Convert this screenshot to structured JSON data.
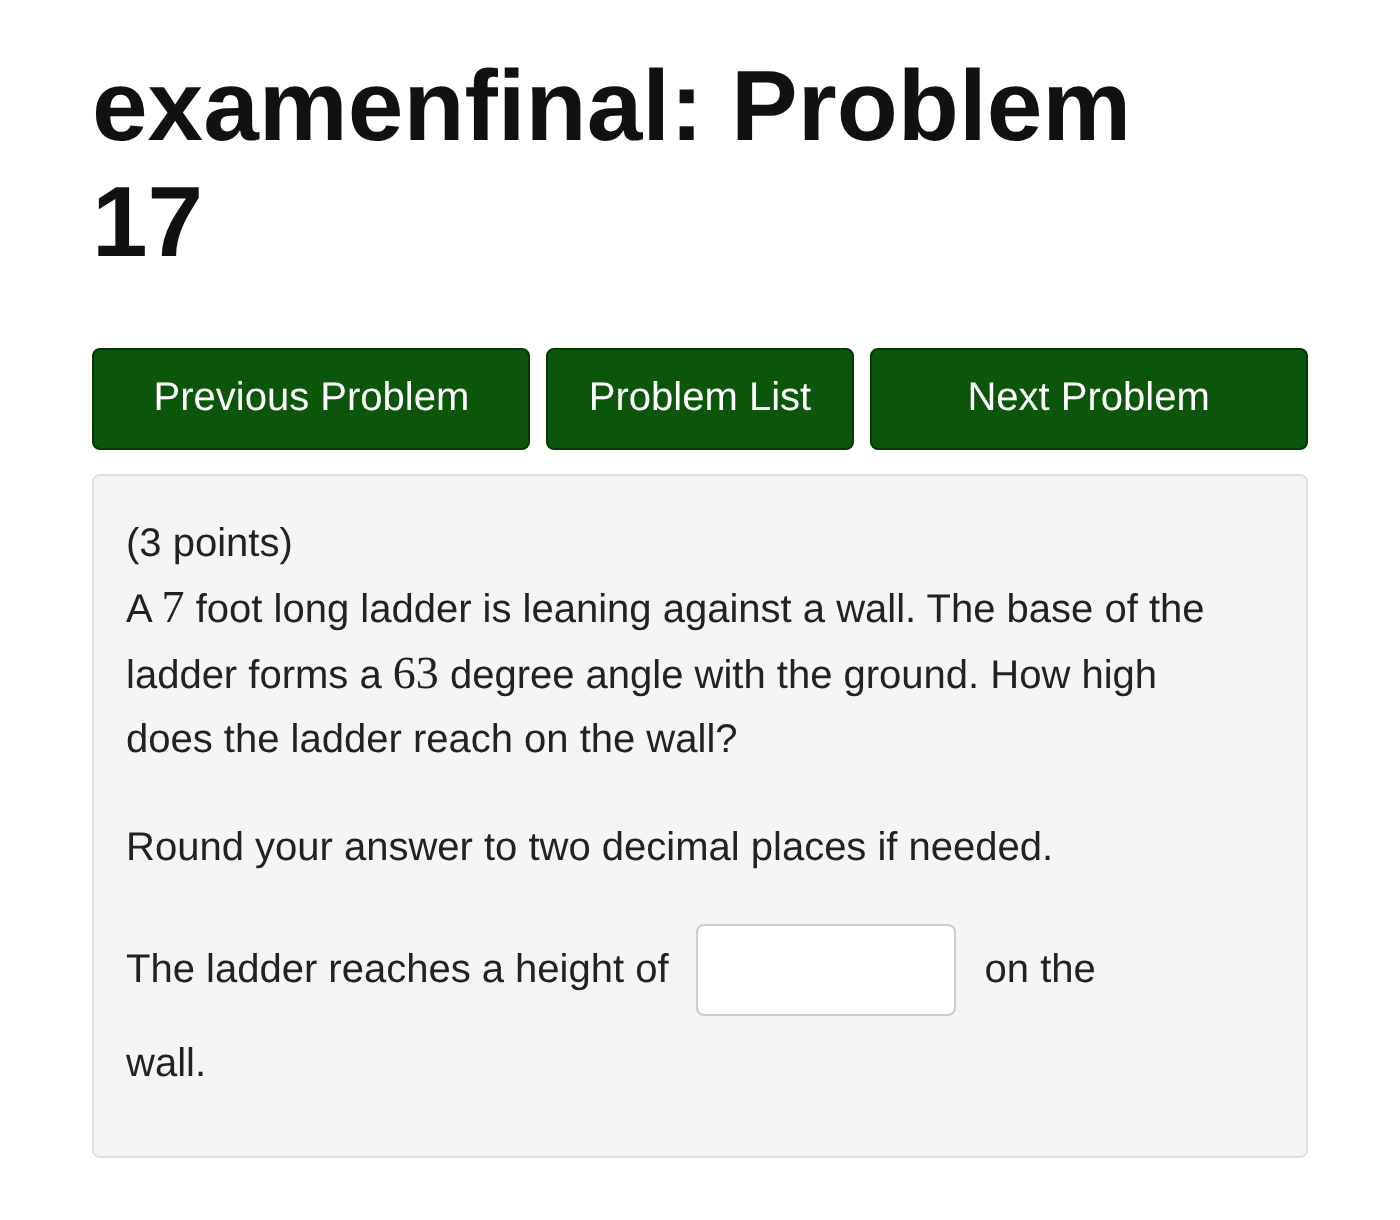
{
  "title": "examenfinal: Problem 17",
  "nav_buttons": [
    "Previous Problem",
    "Problem List",
    "Next Problem"
  ],
  "problem": {
    "points": "(3 points)",
    "statement": [
      {
        "kind": "text",
        "text": "A "
      },
      {
        "kind": "math",
        "text": "7"
      },
      {
        "kind": "text",
        "text": " foot long ladder is leaning against a wall. The base of the ladder forms a "
      },
      {
        "kind": "math",
        "text": "63"
      },
      {
        "kind": "text",
        "text": " degree angle with the ground. How high does the ladder reach on the wall?"
      }
    ],
    "instruction": "Round your answer to two decimal places if needed.",
    "answer_prefix": "The ladder reaches a height of",
    "answer": {
      "kind": "text"
    },
    "answer_suffix": "on the wall."
  }
}
